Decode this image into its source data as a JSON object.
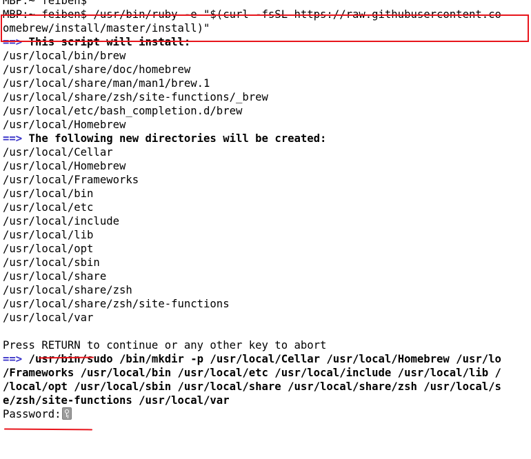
{
  "prompt_prev": "MBP:~ feiben$",
  "command": {
    "line1": "MBP:~ feiben$ /usr/bin/ruby -e \"$(curl -fsSL https://raw.githubusercontent.co",
    "line2": "omebrew/install/master/install)\""
  },
  "arrow": "==>",
  "install": {
    "header": " This script will install:",
    "items": [
      "/usr/local/bin/brew",
      "/usr/local/share/doc/homebrew",
      "/usr/local/share/man/man1/brew.1",
      "/usr/local/share/zsh/site-functions/_brew",
      "/usr/local/etc/bash_completion.d/brew",
      "/usr/local/Homebrew"
    ]
  },
  "directories": {
    "header": " The following new directories will be created:",
    "items": [
      "/usr/local/Cellar",
      "/usr/local/Homebrew",
      "/usr/local/Frameworks",
      "/usr/local/bin",
      "/usr/local/etc",
      "/usr/local/include",
      "/usr/local/lib",
      "/usr/local/opt",
      "/usr/local/sbin",
      "/usr/local/share",
      "/usr/local/share/zsh",
      "/usr/local/share/zsh/site-functions",
      "/usr/local/var"
    ]
  },
  "press_return": "Press RETURN to continue or any other key to abort",
  "sudo": {
    "line1": " /usr/bin/sudo /bin/mkdir -p /usr/local/Cellar /usr/local/Homebrew /usr/lo",
    "line2": "/Frameworks /usr/local/bin /usr/local/etc /usr/local/include /usr/local/lib /",
    "line3": "/local/opt /usr/local/sbin /usr/local/share /usr/local/share/zsh /usr/local/s",
    "line4": "e/zsh/site-functions /usr/local/var"
  },
  "password_prompt": "Password:",
  "icons": {
    "cursor": "key-icon"
  },
  "colors": {
    "arrow": "#3b35c9",
    "highlight": "#e8141b",
    "text": "#000000",
    "background": "#ffffff"
  }
}
